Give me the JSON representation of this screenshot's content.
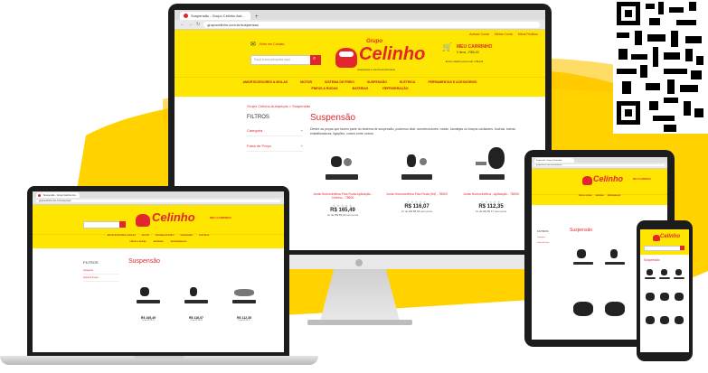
{
  "background": {
    "accent": "#ffd200",
    "brand_red": "#e3262d"
  },
  "browser": {
    "tab_title": "Suspensão - Grupo Celinho Aut...",
    "url": "grupocelinho.com.br/suspensao",
    "new_tab": "+"
  },
  "site": {
    "logo_grupo": "Grupo",
    "logo_name": "Celinho",
    "logo_tagline": "Autopeças e Centro Automotivo",
    "top_links": [
      "Acesse Conta",
      "Minha Conta",
      "Meus Pedidos"
    ],
    "contact_label": "Entre em Contato",
    "search_placeholder": "Faça a sua pesquisa aqui",
    "cart_title": "MEU CARRINHO",
    "cart_info": "0 itens - R$0,00",
    "shipping_info": "Envio rápido para todo o Brasil",
    "nav_row1": [
      "AMORTECEDORES & MOLAS",
      "MOTOR",
      "SISTEMA DE FREIO",
      "SUSPENSÃO",
      "ELÉTRICA",
      "FERRAMENTAS E ACESSÓRIOS"
    ],
    "nav_row2": [
      "PNEUS & RODAS",
      "BATERIAS",
      "REFRIGERAÇÃO"
    ]
  },
  "page": {
    "breadcrumb": "Grupo Celinho Autopeças  >  Suspensão",
    "title": "Suspensão",
    "description": "Dentre as peças que fazem parte do sistema de suspensão, podemos citar: amortecedores, molas, bandejas ou braços oscilantes, buchas, barras estabilizadoras, ligações, coxins entre outros.",
    "filters_title": "FILTROS",
    "filters": [
      {
        "label": "Categoria",
        "icon": "+"
      },
      {
        "label": "Faixa de Preço",
        "icon": "+"
      }
    ]
  },
  "products": [
    {
      "name": "Junta Homocinética Fixa Roda Aplicação - Celinho - 78500",
      "stars": "★★★★★",
      "price": "R$ 165,49",
      "installments": "3x de R$ 55,16 sem juros"
    },
    {
      "name": "Junta Homocinética Fixa Roda (Kit) - 78520",
      "stars": "★★★★★",
      "price": "R$ 116,07",
      "installments": "2x de R$ 58,03 sem juros"
    },
    {
      "name": "Junta Homocinética - Aplicação - 78530",
      "stars": "★★★★★",
      "price": "R$ 112,35",
      "installments": "2x de R$ 56,17 sem juros"
    }
  ],
  "laptop_products": [
    {
      "price": "R$ 165,49",
      "installments": "3x de R$ 55,16"
    },
    {
      "price": "R$ 116,07",
      "installments": "2x de R$ 58,03"
    },
    {
      "price": "R$ 112,35",
      "installments": "2x de R$ 56,17"
    }
  ]
}
